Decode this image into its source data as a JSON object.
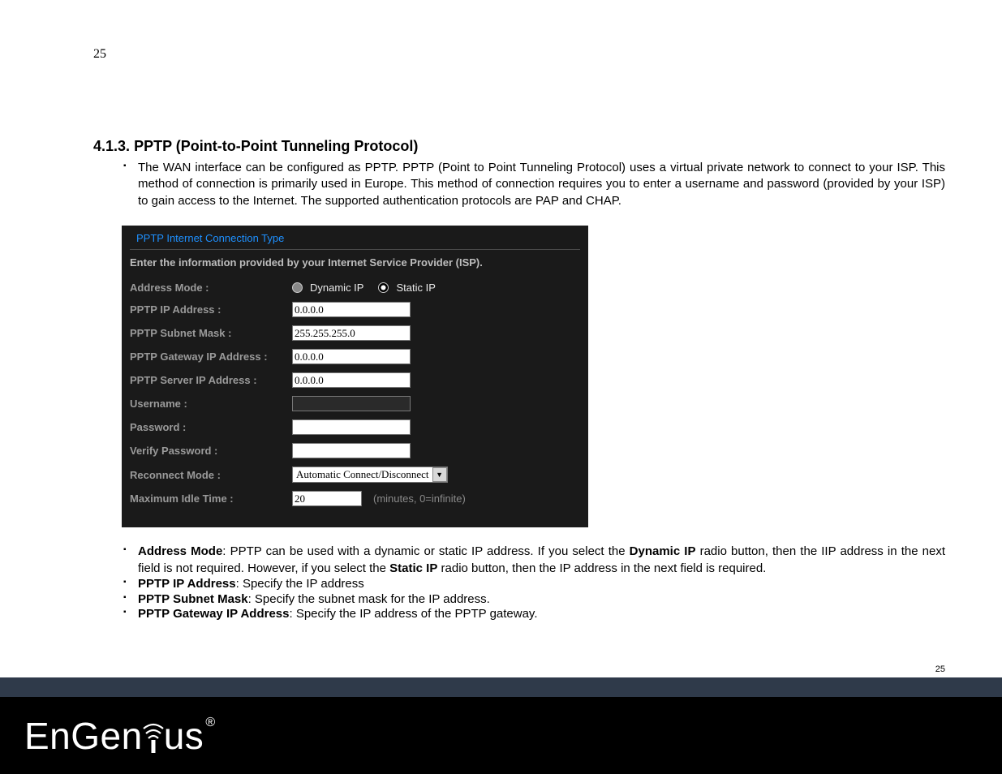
{
  "page_number_top": "25",
  "section": {
    "number": "4.1.3.",
    "title": "PPTP (Point-to-Point Tunneling Protocol)",
    "intro": "The WAN interface can be configured as PPTP. PPTP (Point to Point Tunneling Protocol) uses a virtual private network to connect to your ISP. This method of connection is primarily used in Europe. This method of connection requires you to enter a username and password (provided by your ISP) to gain access to the Internet. The supported authentication protocols are PAP and CHAP."
  },
  "panel": {
    "title": "PPTP Internet Connection Type",
    "subtitle": "Enter the information provided by your Internet Service Provider (ISP).",
    "fields": {
      "address_mode_label": "Address Mode :",
      "radio_dynamic": "Dynamic IP",
      "radio_static": "Static IP",
      "pptp_ip_label": "PPTP IP Address :",
      "pptp_ip_value": "0.0.0.0",
      "subnet_label": "PPTP Subnet Mask :",
      "subnet_value": "255.255.255.0",
      "gateway_label": "PPTP Gateway IP Address :",
      "gateway_value": "0.0.0.0",
      "server_label": "PPTP Server IP Address :",
      "server_value": "0.0.0.0",
      "username_label": "Username :",
      "username_value": "",
      "password_label": "Password :",
      "verify_label": "Verify Password :",
      "reconnect_label": "Reconnect Mode :",
      "reconnect_value": "Automatic Connect/Disconnect",
      "idle_label": "Maximum Idle Time :",
      "idle_value": "20",
      "idle_hint": "(minutes, 0=infinite)"
    }
  },
  "descriptions": {
    "address_mode_term": "Address Mode",
    "address_mode_text1": ": PPTP can be used with a dynamic or static IP address. If you select the ",
    "address_mode_dyn": "Dynamic IP",
    "address_mode_text2": " radio button, then the IIP address in the next field is not required. However, if you select the ",
    "address_mode_static": "Static IP",
    "address_mode_text3": " radio button, then the IP address in the next field is required.",
    "pptp_ip_term": "PPTP IP Address",
    "pptp_ip_text": ": Specify the IP address",
    "subnet_term": "PPTP Subnet Mask",
    "subnet_text": ": Specify the subnet mask for the IP address.",
    "gateway_term": "PPTP Gateway IP Address",
    "gateway_text": ": Specify the IP address of the PPTP gateway."
  },
  "footer": {
    "page_number": "25",
    "logo_text1": "EnGen",
    "logo_text2": "us"
  }
}
